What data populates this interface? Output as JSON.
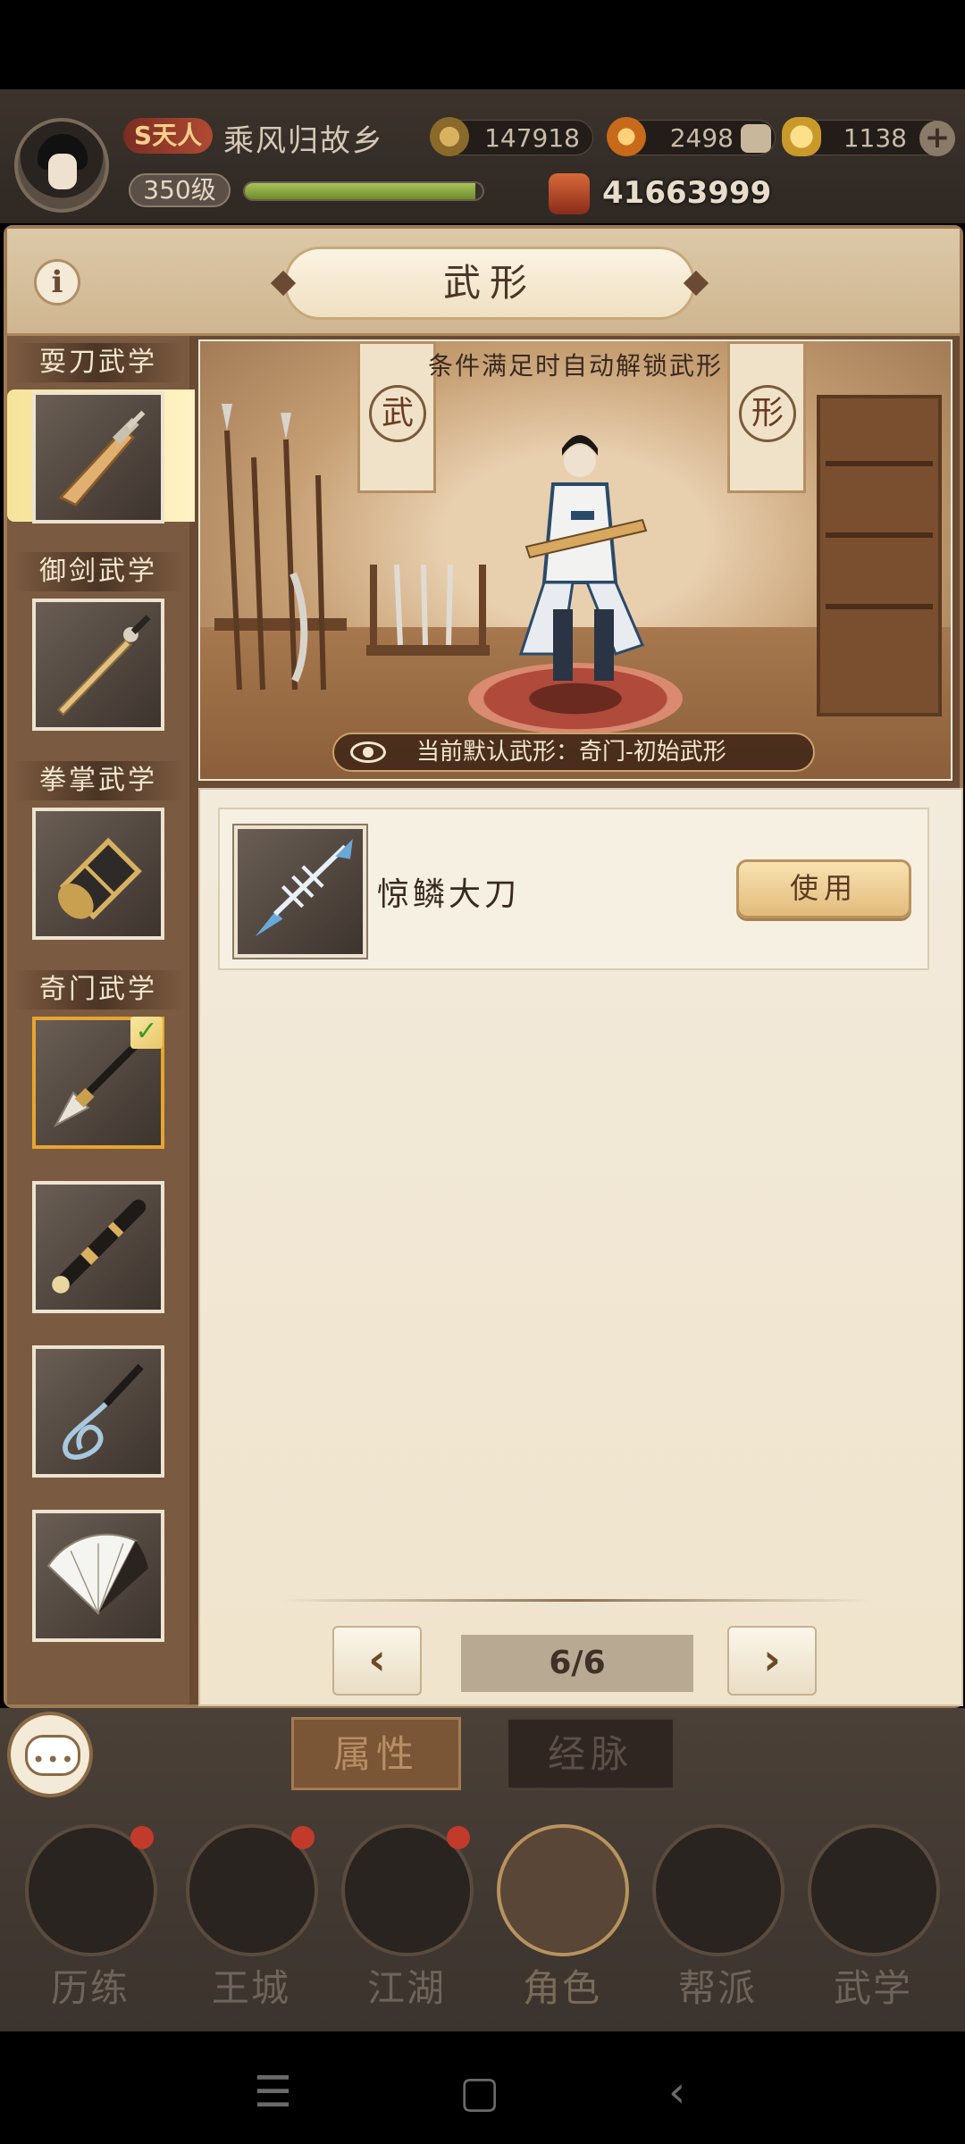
{
  "player": {
    "vip_label": "S天人",
    "name": "乘风归故乡",
    "level": "350级",
    "exp_fraction": 0.97,
    "power": "41663999"
  },
  "resources": {
    "copper": "147918",
    "coins": "2498",
    "ingots": "1138"
  },
  "panel": {
    "title": "武形",
    "info_icon": "info-icon"
  },
  "categories": [
    {
      "label": "耍刀武学",
      "icon": "saber-icon"
    },
    {
      "label": "御剑武学",
      "icon": "sword-icon"
    },
    {
      "label": "拳掌武学",
      "icon": "gauntlet-icon"
    },
    {
      "label": "奇门武学",
      "icon": "spear-icon"
    }
  ],
  "extra_slots": [
    "flute-icon",
    "whip-icon",
    "fan-icon"
  ],
  "scene": {
    "unlock_note": "条件满足时自动解锁武形",
    "banner_left": "武",
    "banner_right": "形",
    "default_form": "当前默认武形：奇门-初始武形"
  },
  "items": [
    {
      "name": "惊鳞大刀",
      "icon": "fishbone-blade-icon",
      "action": "使用"
    }
  ],
  "pagination": {
    "text": "6/6",
    "prev": "‹",
    "next": "›"
  },
  "subtabs": {
    "attributes": "属性",
    "meridians": "经脉"
  },
  "bottom_nav": [
    "历练",
    "王城",
    "江湖",
    "角色",
    "帮派",
    "武学"
  ],
  "colors": {
    "accent_gold": "#e6a532",
    "check_green": "#3a9a2a",
    "panel_brown": "#6b4a33",
    "badge_red": "#c23a2a"
  }
}
